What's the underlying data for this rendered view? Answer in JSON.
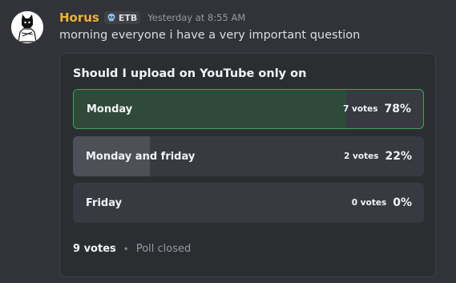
{
  "author": {
    "username": "Horus",
    "tag": "ETB",
    "tag_icon": "skull-icon",
    "timestamp": "Yesterday at 8:55 AM"
  },
  "message": {
    "content": "morning everyone i have a very important question"
  },
  "poll": {
    "question": "Should I upload on YouTube only on",
    "answers": [
      {
        "label": "Monday",
        "votes": "7 votes",
        "percent": "78%",
        "fraction": 0.78,
        "selected": true
      },
      {
        "label": "Monday and friday",
        "votes": "2 votes",
        "percent": "22%",
        "fraction": 0.22,
        "selected": false
      },
      {
        "label": "Friday",
        "votes": "0 votes",
        "percent": "0%",
        "fraction": 0.0,
        "selected": false
      }
    ],
    "total_votes": "9 votes",
    "separator": "•",
    "status": "Poll closed"
  },
  "colors": {
    "background": "#313338",
    "username": "#f0b232",
    "selected_border": "#3ba55d",
    "selected_fill": "#2f4a3a"
  }
}
